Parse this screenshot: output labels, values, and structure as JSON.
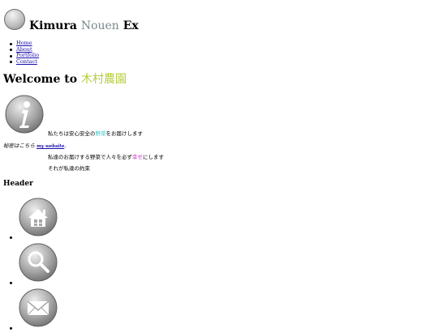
{
  "site": {
    "title_part1": "Kimura",
    "title_accent": "Nouen",
    "title_part3": "Ex",
    "logo_icon": "gray-circle-logo"
  },
  "nav": {
    "items": [
      {
        "label": "Home"
      },
      {
        "label": "About"
      },
      {
        "label": "Portfolio"
      },
      {
        "label": "Contact"
      }
    ]
  },
  "welcome": {
    "prefix": "Welcome to",
    "name_jp": "木村農園"
  },
  "content": {
    "info_icon": "info-icon",
    "line1_before": "私たちは安心安全の",
    "line1_highlight": "野菜",
    "line1_after": "をお届けします",
    "line2_text": "秘密はこちら",
    "line2_link": "my website",
    "line2_end": ".",
    "line3_before": "私達のお届けする野菜で人々を必ず",
    "line3_highlight": "幸せ",
    "line3_after": "にします",
    "line4": "それが私達の約束"
  },
  "header_section": {
    "label": "Header",
    "icons": [
      "home-icon",
      "search-icon",
      "mail-icon"
    ]
  },
  "colors": {
    "title_accent": "#7a8a8c",
    "welcome_accent": "#b5cc3a",
    "cyan": "#33cccc",
    "magenta": "#cc33cc",
    "link": "#1a0dab"
  }
}
